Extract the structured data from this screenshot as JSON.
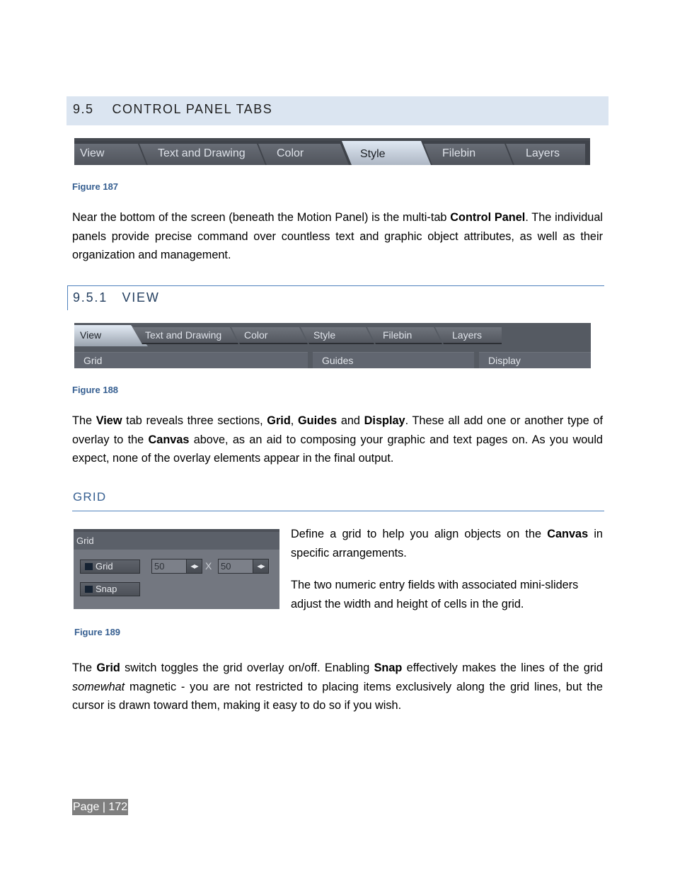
{
  "section": {
    "number": "9.5",
    "title": "CONTROL PANEL TABS"
  },
  "figure187": {
    "tabs": [
      {
        "label": "View",
        "active": false
      },
      {
        "label": "Text and Drawing",
        "active": false
      },
      {
        "label": "Color",
        "active": false
      },
      {
        "label": "Style",
        "active": true
      },
      {
        "label": "Filebin",
        "active": false
      },
      {
        "label": "Layers",
        "active": false
      }
    ],
    "caption": "Figure 187"
  },
  "intro_paragraph": {
    "part1": "Near the bottom of the screen (beneath the Motion Panel) is the multi-tab ",
    "bold1": "Control Panel",
    "part2": ". The individual panels provide precise command over countless text and graphic object attributes, as well as their organization and management."
  },
  "subsection": {
    "number": "9.5.1",
    "title": "VIEW"
  },
  "figure188": {
    "tabs": [
      {
        "label": "View",
        "active": true
      },
      {
        "label": "Text and Drawing",
        "active": false
      },
      {
        "label": "Color",
        "active": false
      },
      {
        "label": "Style",
        "active": false
      },
      {
        "label": "Filebin",
        "active": false
      },
      {
        "label": "Layers",
        "active": false
      }
    ],
    "sections": [
      "Grid",
      "Guides",
      "Display"
    ],
    "caption": "Figure 188"
  },
  "view_paragraph": {
    "t1": "The ",
    "b1": "View",
    "t2": " tab reveals three sections, ",
    "b2": "Grid",
    "t3": ", ",
    "b3": "Guides",
    "t4": " and ",
    "b4": "Display",
    "t5": ".  These all add one or another type of overlay to the ",
    "b5": "Canvas",
    "t6": " above, as an aid to composing your graphic and text pages on.  As you would expect, none of the overlay elements appear in the final output."
  },
  "grid_heading": "GRID",
  "figure189": {
    "panel_title": "Grid",
    "grid_toggle_label": "Grid",
    "snap_toggle_label": "Snap",
    "width_value": "50",
    "height_value": "50",
    "separator": "X",
    "spin_glyph": "◀▶",
    "caption": "Figure 189"
  },
  "grid_side_text": {
    "p1_t1": "Define a grid to help you align objects on the ",
    "p1_b1": "Canvas",
    "p1_t2": " in specific arrangements.",
    "p2": "The two numeric entry fields with associated mini-sliders adjust the width and height of cells in the grid."
  },
  "grid_paragraph": {
    "t1": "The ",
    "b1": "Grid",
    "t2": " switch toggles the grid overlay on/off. Enabling ",
    "b2": "Snap",
    "t3": " effectively makes the lines of the grid ",
    "i1": "somewhat",
    "t4": " magnetic - you are not restricted to placing items exclusively along the grid lines, but the cursor is drawn toward them, making it easy to do so if you wish."
  },
  "footer": {
    "page_label": "Page | 172"
  }
}
